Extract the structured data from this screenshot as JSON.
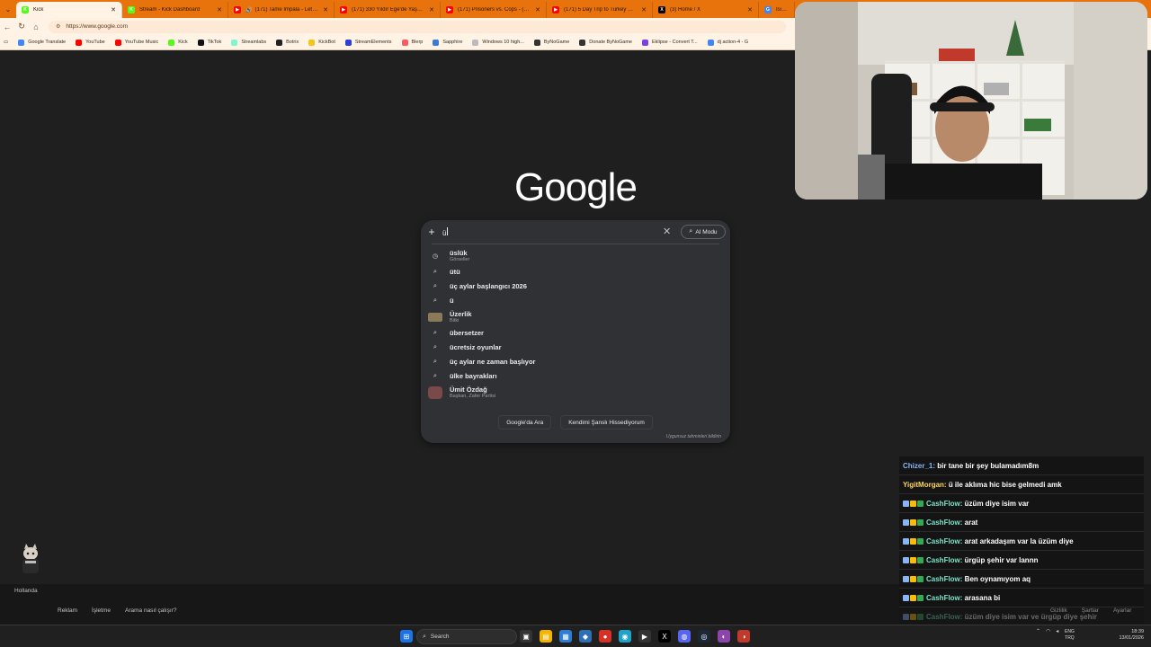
{
  "browser": {
    "tabs": [
      {
        "title": "Kick",
        "favicon_color": "#53fc18",
        "favicon_letter": "K",
        "active": true,
        "audio": false
      },
      {
        "title": "Stream - Kick Dashboard",
        "favicon_color": "#53fc18",
        "favicon_letter": "K",
        "active": false,
        "audio": false
      },
      {
        "title": "(171) Tame Impala - Let It Hap",
        "favicon_color": "#ff0000",
        "favicon_letter": "▶",
        "active": false,
        "audio": true
      },
      {
        "title": "(171) 330 Yıldır Ege'de Yaşayan A",
        "favicon_color": "#ff0000",
        "favicon_letter": "▶",
        "active": false,
        "audio": false
      },
      {
        "title": "(171) Prisoners vs. Cops - (Who's",
        "favicon_color": "#ff0000",
        "favicon_letter": "▶",
        "active": false,
        "audio": false
      },
      {
        "title": "(171) 5 Day Trip to Turkey on Turk",
        "favicon_color": "#ff0000",
        "favicon_letter": "▶",
        "active": false,
        "audio": false
      },
      {
        "title": "(3) Home / X",
        "favicon_color": "#000000",
        "favicon_letter": "X",
        "active": false,
        "audio": false
      },
      {
        "title": "İsim B",
        "favicon_color": "#4285f4",
        "favicon_letter": "G",
        "active": false,
        "audio": false
      }
    ],
    "url": "https://www.google.com",
    "bookmarks": [
      {
        "label": "Google Translate",
        "color": "#4285f4"
      },
      {
        "label": "YouTube",
        "color": "#ff0000"
      },
      {
        "label": "YouTube Music",
        "color": "#ff0000"
      },
      {
        "label": "Kick",
        "color": "#53fc18"
      },
      {
        "label": "TikTok",
        "color": "#111111"
      },
      {
        "label": "Streamlabs",
        "color": "#80f5d2"
      },
      {
        "label": "Botrix",
        "color": "#222222"
      },
      {
        "label": "KickBot",
        "color": "#f5c518"
      },
      {
        "label": "StreamElements",
        "color": "#2d3fd6"
      },
      {
        "label": "Blerp",
        "color": "#ff5a5f"
      },
      {
        "label": "Sapphire",
        "color": "#3a7bd5"
      },
      {
        "label": "Windows 10 high...",
        "color": "#bbbbbb"
      },
      {
        "label": "ByNoGame",
        "color": "#333333"
      },
      {
        "label": "Donate ByNoGame",
        "color": "#333333"
      },
      {
        "label": "Eklipse - Convert T...",
        "color": "#7b3fe4"
      },
      {
        "label": "dj action-4 - G",
        "color": "#4285f4"
      }
    ]
  },
  "google": {
    "logo": "Google",
    "query": "ü",
    "ai_mode_label": "AI Modu",
    "suggestions": [
      {
        "text": "üslük",
        "sub": "Görseller",
        "icon": "history-icon"
      },
      {
        "text": "ütü",
        "sub": "",
        "icon": "search-icon"
      },
      {
        "text": "üç aylar başlangıcı 2026",
        "sub": "",
        "icon": "search-icon"
      },
      {
        "text": "ü",
        "sub": "",
        "icon": "search-icon"
      },
      {
        "text": "Üzerlik",
        "sub": "Bitki",
        "icon": "thumbnail"
      },
      {
        "text": "übersetzer",
        "sub": "",
        "icon": "search-icon"
      },
      {
        "text": "ücretsiz oyunlar",
        "sub": "",
        "icon": "search-icon"
      },
      {
        "text": "üç aylar ne zaman başlıyor",
        "sub": "",
        "icon": "search-icon"
      },
      {
        "text": "ülke bayrakları",
        "sub": "",
        "icon": "search-icon"
      },
      {
        "text": "Ümit Özdağ",
        "sub": "Başkan, Zafer Partisi",
        "icon": "avatar"
      }
    ],
    "search_button": "Google'da Ara",
    "lucky_button": "Kendimi Şanslı Hissediyorum",
    "report_text": "Uygunsuz tahminleri bildirin"
  },
  "footer": {
    "country": "Hollanda",
    "left_links": [
      "Reklam",
      "İşletme",
      "Arama nasıl çalışır?"
    ],
    "right_links": [
      "Gizlilik",
      "Şartlar",
      "Ayarlar"
    ]
  },
  "chat": [
    {
      "user": "Chizer_1",
      "color": "#8ab4f8",
      "badges": false,
      "message": "bir tane bir şey bulamadım8m"
    },
    {
      "user": "YigitMorgan",
      "color": "#fdd663",
      "badges": false,
      "message": "ü ile aklıma hic bise gelmedi amk"
    },
    {
      "user": "CashFlow",
      "color": "#7ee2c7",
      "badges": true,
      "message": "üzüm diye isim var"
    },
    {
      "user": "CashFlow",
      "color": "#7ee2c7",
      "badges": true,
      "message": "arat"
    },
    {
      "user": "CashFlow",
      "color": "#7ee2c7",
      "badges": true,
      "message": "arat arkadaşım var la üzüm diye"
    },
    {
      "user": "CashFlow",
      "color": "#7ee2c7",
      "badges": true,
      "message": "ürgüp şehir var lannn"
    },
    {
      "user": "CashFlow",
      "color": "#7ee2c7",
      "badges": true,
      "message": "Ben oynamıyom aq"
    },
    {
      "user": "CashFlow",
      "color": "#7ee2c7",
      "badges": true,
      "message": "arasana bi"
    },
    {
      "user": "CashFlow",
      "color": "#7ee2c7",
      "badges": true,
      "message": "üzüm diye isim var ve ürgüp diye şehir"
    }
  ],
  "taskbar": {
    "search_placeholder": "Search",
    "lang_top": "ENG",
    "lang_bottom": "TRQ",
    "time": "18:39",
    "date": "13/01/2026"
  },
  "colors": {
    "tab_strip": "#e8720c",
    "page_bg": "#1f1f1f",
    "search_box_bg": "#303134"
  }
}
